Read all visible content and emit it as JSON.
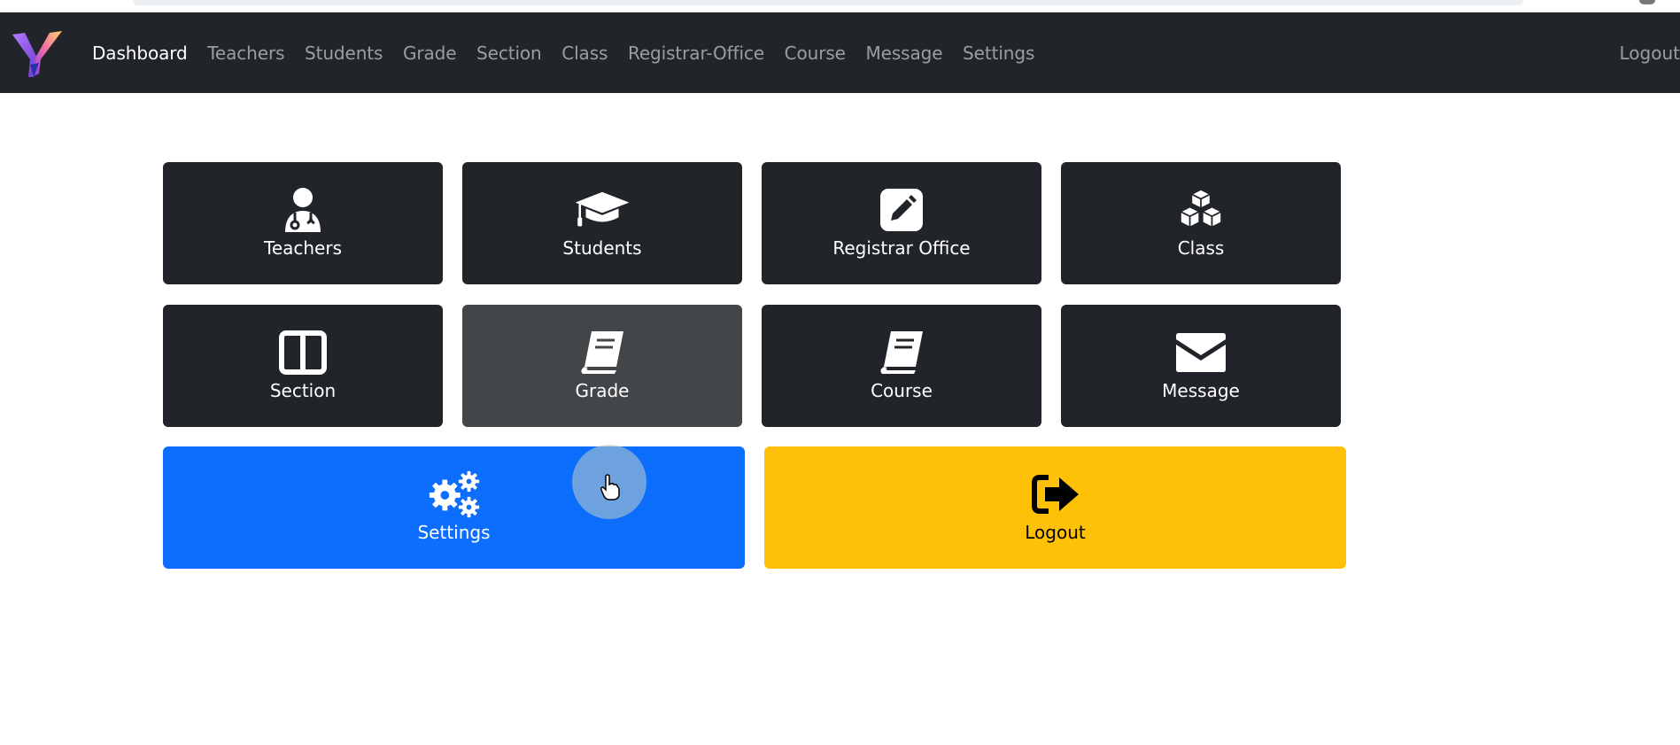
{
  "navbar": {
    "brand_icon": "y-logo-icon",
    "links": [
      "Dashboard",
      "Teachers",
      "Students",
      "Grade",
      "Section",
      "Class",
      "Registrar-Office",
      "Course",
      "Message",
      "Settings"
    ],
    "active": "Dashboard",
    "logout": "Logout"
  },
  "tiles": [
    {
      "label": "Teachers",
      "icon": "doctor-user-icon",
      "color": "#212529"
    },
    {
      "label": "Students",
      "icon": "graduation-cap-icon",
      "color": "#212529"
    },
    {
      "label": "Registrar Office",
      "icon": "pencil-square-icon",
      "color": "#212529"
    },
    {
      "label": "Class",
      "icon": "cubes-icon",
      "color": "#212529"
    },
    {
      "label": "Section",
      "icon": "columns-icon",
      "color": "#212529"
    },
    {
      "label": "Grade",
      "icon": "book-icon",
      "color": "#424649"
    },
    {
      "label": "Course",
      "icon": "book-icon",
      "color": "#212529"
    },
    {
      "label": "Message",
      "icon": "envelope-icon",
      "color": "#212529"
    },
    {
      "label": "Settings",
      "icon": "gears-icon",
      "color": "#0d6efd"
    },
    {
      "label": "Logout",
      "icon": "sign-out-icon",
      "color": "#ffc107"
    }
  ]
}
